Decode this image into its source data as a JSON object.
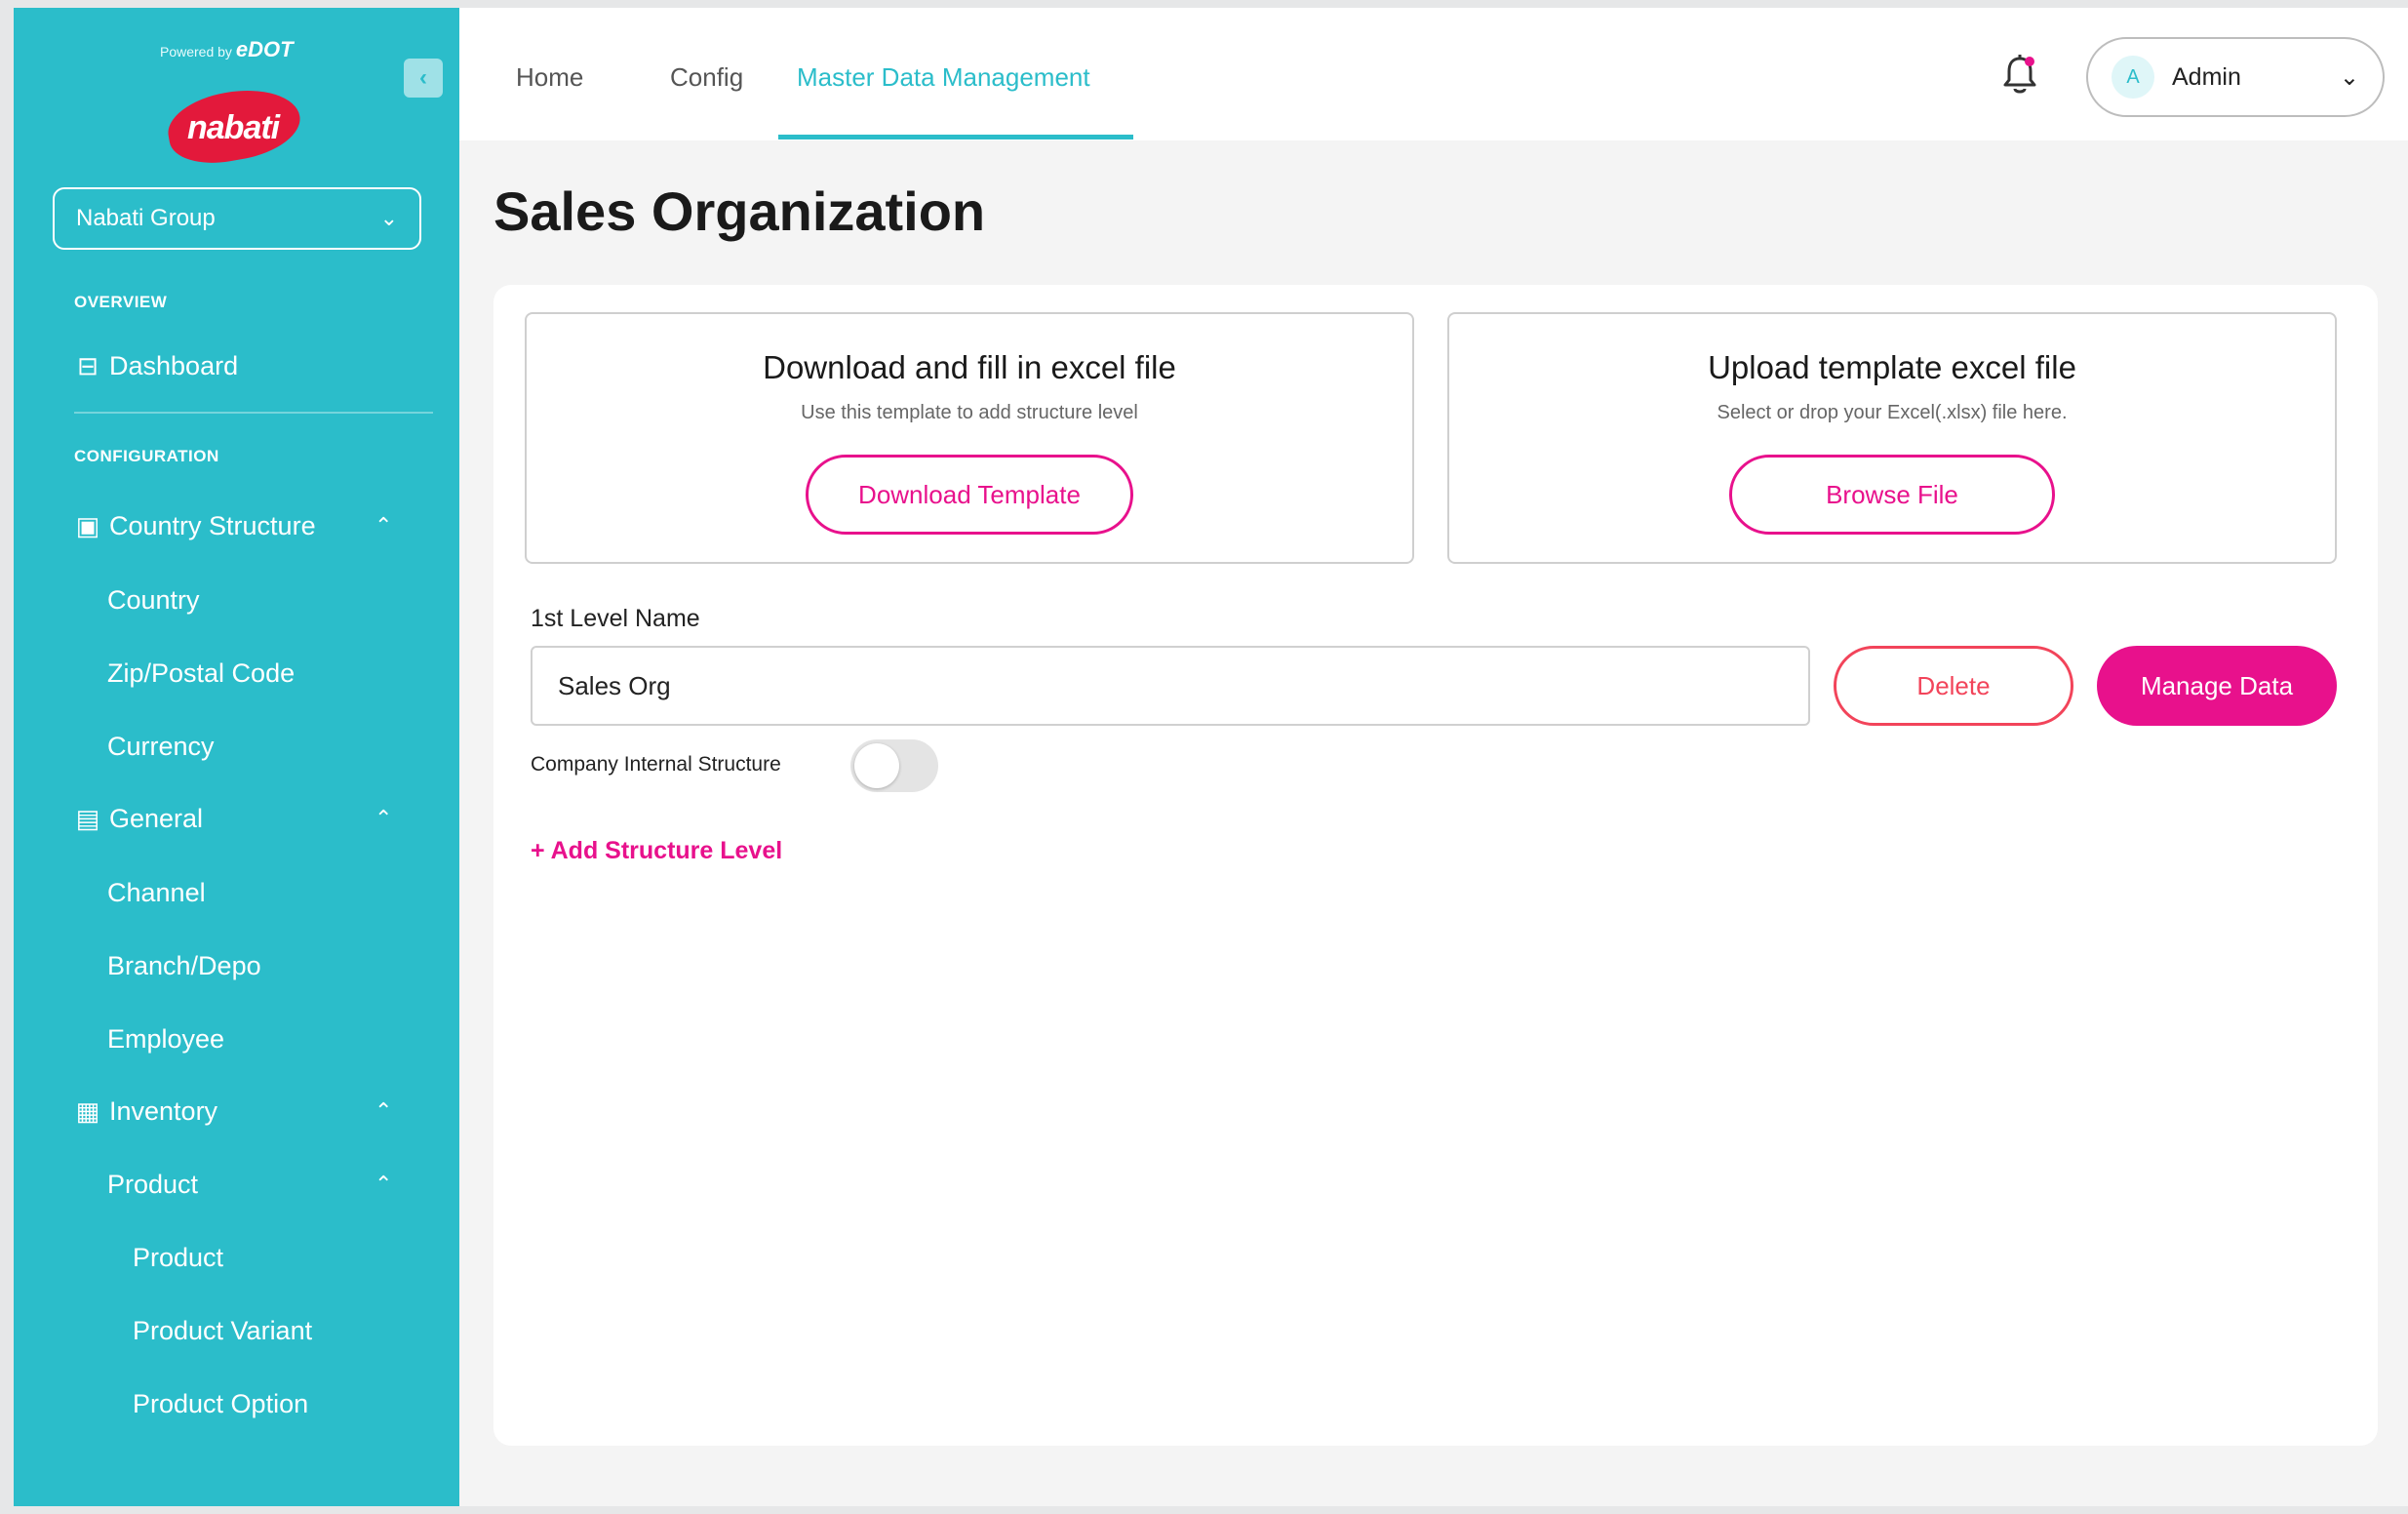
{
  "brand": {
    "powered_by": "Powered by",
    "edot": "eDOT",
    "logo_text": "nabati"
  },
  "sidebar": {
    "group_select": "Nabati Group",
    "sections": {
      "overview": "OVERVIEW",
      "configuration": "CONFIGURATION"
    },
    "dashboard": "Dashboard",
    "country_structure": "Country Structure",
    "country": "Country",
    "zip": "Zip/Postal Code",
    "currency": "Currency",
    "general": "General",
    "channel": "Channel",
    "branch": "Branch/Depo",
    "employee": "Employee",
    "inventory": "Inventory",
    "product_group": "Product",
    "product": "Product",
    "product_variant": "Product Variant",
    "product_option": "Product Option"
  },
  "topbar": {
    "tabs": [
      "Home",
      "Config",
      "Master Data Management"
    ],
    "active_tab": "Master Data Management",
    "user_initial": "A",
    "user_name": "Admin"
  },
  "page": {
    "title": "Sales Organization",
    "download": {
      "title": "Download and fill in excel file",
      "subtitle": "Use this template to add structure level",
      "button": "Download Template"
    },
    "upload": {
      "title": "Upload template excel file",
      "subtitle": "Select or drop your Excel(.xlsx) file here.",
      "button": "Browse File"
    },
    "level_label": "1st Level Name",
    "level_value": "Sales Org",
    "delete_label": "Delete",
    "manage_label": "Manage Data",
    "toggle_label": "Company Internal Structure",
    "toggle_on": false,
    "add_link": "+ Add Structure Level"
  },
  "colors": {
    "sidebar": "#2bbdca",
    "accent": "#e8118c",
    "danger": "#f2445a"
  }
}
